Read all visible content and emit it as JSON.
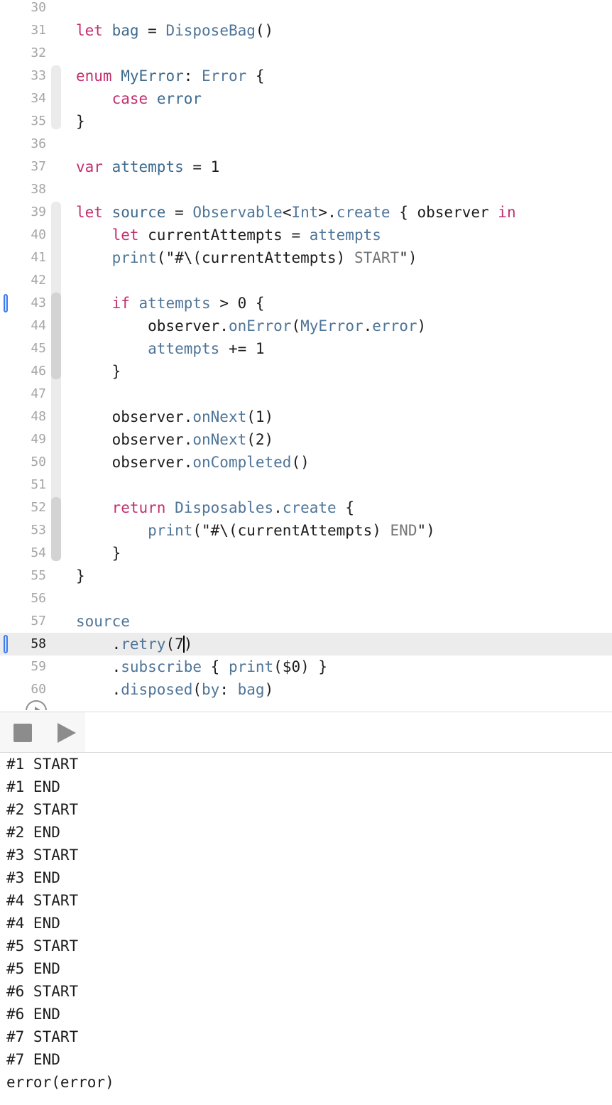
{
  "editor": {
    "lines": [
      {
        "num": "30",
        "tokens": []
      },
      {
        "num": "31",
        "tokens": [
          [
            "kw",
            "let"
          ],
          [
            "pl",
            " "
          ],
          [
            "ty",
            "bag"
          ],
          [
            "pl",
            " = "
          ],
          [
            "fn",
            "DisposeBag"
          ],
          [
            "pl",
            "()"
          ]
        ]
      },
      {
        "num": "32",
        "tokens": []
      },
      {
        "num": "33",
        "tokens": [
          [
            "kw",
            "enum"
          ],
          [
            "pl",
            " "
          ],
          [
            "ty",
            "MyError"
          ],
          [
            "pl",
            ": "
          ],
          [
            "fn",
            "Error"
          ],
          [
            "pl",
            " {"
          ]
        ]
      },
      {
        "num": "34",
        "tokens": [
          [
            "pl",
            "    "
          ],
          [
            "kw",
            "case"
          ],
          [
            "pl",
            " "
          ],
          [
            "ty",
            "error"
          ]
        ]
      },
      {
        "num": "35",
        "tokens": [
          [
            "pl",
            "}"
          ]
        ]
      },
      {
        "num": "36",
        "tokens": []
      },
      {
        "num": "37",
        "tokens": [
          [
            "kw",
            "var"
          ],
          [
            "pl",
            " "
          ],
          [
            "ty",
            "attempts"
          ],
          [
            "pl",
            " = 1"
          ]
        ]
      },
      {
        "num": "38",
        "tokens": []
      },
      {
        "num": "39",
        "tokens": [
          [
            "kw",
            "let"
          ],
          [
            "pl",
            " "
          ],
          [
            "ty",
            "source"
          ],
          [
            "pl",
            " = "
          ],
          [
            "fn",
            "Observable"
          ],
          [
            "pl",
            "<"
          ],
          [
            "fn",
            "Int"
          ],
          [
            "pl",
            ">."
          ],
          [
            "mb",
            "create"
          ],
          [
            "pl",
            " { observer "
          ],
          [
            "kw",
            "in"
          ]
        ]
      },
      {
        "num": "40",
        "tokens": [
          [
            "pl",
            "    "
          ],
          [
            "kw",
            "let"
          ],
          [
            "pl",
            " currentAttempts = "
          ],
          [
            "mb",
            "attempts"
          ]
        ]
      },
      {
        "num": "41",
        "tokens": [
          [
            "pl",
            "    "
          ],
          [
            "fn",
            "print"
          ],
          [
            "pl",
            "(\"#\\(currentAttempts) "
          ],
          [
            "str",
            "START"
          ],
          [
            "pl",
            "\")"
          ]
        ]
      },
      {
        "num": "42",
        "tokens": []
      },
      {
        "num": "43",
        "tokens": [
          [
            "pl",
            "    "
          ],
          [
            "kw",
            "if"
          ],
          [
            "pl",
            " "
          ],
          [
            "mb",
            "attempts"
          ],
          [
            "pl",
            " > 0 {"
          ]
        ]
      },
      {
        "num": "44",
        "tokens": [
          [
            "pl",
            "        observer."
          ],
          [
            "mb",
            "onError"
          ],
          [
            "pl",
            "("
          ],
          [
            "fn",
            "MyError"
          ],
          [
            "pl",
            "."
          ],
          [
            "mb",
            "error"
          ],
          [
            "pl",
            ")"
          ]
        ]
      },
      {
        "num": "45",
        "tokens": [
          [
            "pl",
            "        "
          ],
          [
            "mb",
            "attempts"
          ],
          [
            "pl",
            " += 1"
          ]
        ]
      },
      {
        "num": "46",
        "tokens": [
          [
            "pl",
            "    }"
          ]
        ]
      },
      {
        "num": "47",
        "tokens": []
      },
      {
        "num": "48",
        "tokens": [
          [
            "pl",
            "    observer."
          ],
          [
            "mb",
            "onNext"
          ],
          [
            "pl",
            "(1)"
          ]
        ]
      },
      {
        "num": "49",
        "tokens": [
          [
            "pl",
            "    observer."
          ],
          [
            "mb",
            "onNext"
          ],
          [
            "pl",
            "(2)"
          ]
        ]
      },
      {
        "num": "50",
        "tokens": [
          [
            "pl",
            "    observer."
          ],
          [
            "mb",
            "onCompleted"
          ],
          [
            "pl",
            "()"
          ]
        ]
      },
      {
        "num": "51",
        "tokens": []
      },
      {
        "num": "52",
        "tokens": [
          [
            "pl",
            "    "
          ],
          [
            "kw",
            "return"
          ],
          [
            "pl",
            " "
          ],
          [
            "fn",
            "Disposables"
          ],
          [
            "pl",
            "."
          ],
          [
            "mb",
            "create"
          ],
          [
            "pl",
            " {"
          ]
        ]
      },
      {
        "num": "53",
        "tokens": [
          [
            "pl",
            "        "
          ],
          [
            "fn",
            "print"
          ],
          [
            "pl",
            "(\"#\\(currentAttempts) "
          ],
          [
            "str",
            "END"
          ],
          [
            "pl",
            "\")"
          ]
        ]
      },
      {
        "num": "54",
        "tokens": [
          [
            "pl",
            "    }"
          ]
        ]
      },
      {
        "num": "55",
        "tokens": [
          [
            "pl",
            "}"
          ]
        ]
      },
      {
        "num": "56",
        "tokens": []
      },
      {
        "num": "57",
        "tokens": [
          [
            "mb",
            "source"
          ]
        ]
      },
      {
        "num": "58",
        "tokens": [
          [
            "pl",
            "    ."
          ],
          [
            "mb",
            "retry"
          ],
          [
            "pl",
            "(7"
          ],
          [
            "cursor",
            ""
          ],
          [
            "pl",
            ")"
          ]
        ]
      },
      {
        "num": "59",
        "tokens": [
          [
            "pl",
            "    ."
          ],
          [
            "mb",
            "subscribe"
          ],
          [
            "pl",
            " { "
          ],
          [
            "fn",
            "print"
          ],
          [
            "pl",
            "($0) }"
          ]
        ]
      },
      {
        "num": "60",
        "tokens": [
          [
            "pl",
            "    ."
          ],
          [
            "mb",
            "disposed"
          ],
          [
            "pl",
            "("
          ],
          [
            "mb",
            "by"
          ],
          [
            "pl",
            ": "
          ],
          [
            "mb",
            "bag"
          ],
          [
            "pl",
            ")"
          ]
        ]
      }
    ],
    "current_line": "58",
    "breakpoint_lines": [
      "43",
      "58"
    ]
  },
  "toolbar": {
    "stop_icon": "stop-square-icon",
    "run_icon": "play-triangle-icon"
  },
  "console": {
    "lines": [
      "#1 START",
      "#1 END",
      "#2 START",
      "#2 END",
      "#3 START",
      "#3 END",
      "#4 START",
      "#4 END",
      "#5 START",
      "#5 END",
      "#6 START",
      "#6 END",
      "#7 START",
      "#7 END",
      "error(error)"
    ]
  },
  "colors": {
    "keyword": "#c1306f",
    "type": "#3d6a8e",
    "member": "#4f7598",
    "string": "#757575",
    "breakpoint": "#3f7cf2"
  }
}
